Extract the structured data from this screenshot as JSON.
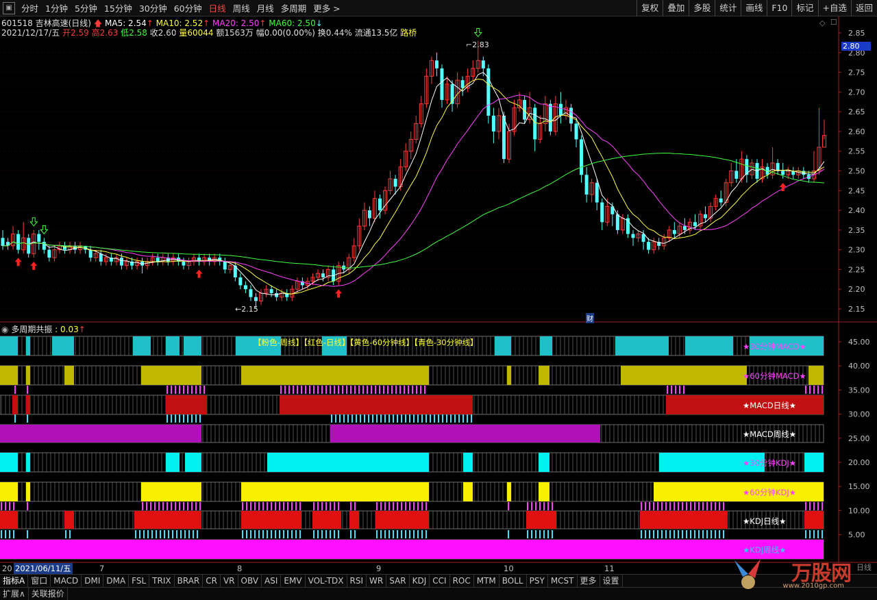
{
  "topbar": {
    "periods": [
      "分时",
      "1分钟",
      "5分钟",
      "15分钟",
      "30分钟",
      "60分钟",
      "日线",
      "周线",
      "月线",
      "多周期",
      "更多 >"
    ],
    "active_period": "日线",
    "right_buttons": [
      "复权",
      "叠加",
      "多股",
      "统计",
      "画线",
      "F10",
      "标记",
      "+自选",
      "返回"
    ]
  },
  "stock": {
    "code_name": "601518 吉林高速(日线)",
    "ma5": "MA5: 2.54",
    "ma10": "MA10: 2.52",
    "ma20": "MA20: 2.50",
    "ma60": "MA60: 2.50",
    "date": "2021/12/17/五",
    "open_label": "开",
    "open": "2.59",
    "high_label": "高",
    "high": "2.63",
    "low_label": "低",
    "low": "2.58",
    "close_label": "收",
    "close": "2.60",
    "vol_label": "量",
    "vol": "60044",
    "amount": "额1563万",
    "change": "幅0.00(0.00%)",
    "turnover": "换0.44%",
    "float": "流通13.5亿",
    "concept": "路桥"
  },
  "colors": {
    "up": "#ff3b3b",
    "down": "#54ffff",
    "ma5": "#ffffff",
    "ma10": "#ffff40",
    "ma20": "#ff40ff",
    "ma60": "#40ff40"
  },
  "price_axis": {
    "ticks": [
      "2.85",
      "2.80",
      "2.75",
      "2.70",
      "2.65",
      "2.60",
      "2.55",
      "2.50",
      "2.45",
      "2.40",
      "2.35",
      "2.30",
      "2.25",
      "2.20",
      "2.15"
    ],
    "current": "2.80"
  },
  "annotations": {
    "high": "2.83",
    "low": "2.15",
    "cai_icon": "财"
  },
  "indicator": {
    "title": "多周期共振",
    "value": ": 0.03",
    "legend": "【粉色-周线】【红色-日线】【黄色-60分钟线】【青色-30分钟线】",
    "axis_ticks": [
      "45.00",
      "40.00",
      "35.00",
      "30.00",
      "25.00",
      "20.00",
      "15.00",
      "10.00",
      "5.00"
    ],
    "row_labels": [
      "★30分钟MACD★",
      "★60分钟MACD★",
      "★MACD日线★",
      "★MACD周线★",
      "★30分钟KDJ★",
      "★60分钟KDJ★",
      "★KDJ日线★",
      "★KDJ周线★"
    ]
  },
  "date_axis": {
    "current": "2021/06/11/五",
    "prefix": "20",
    "months": [
      "7",
      "8",
      "9",
      "10",
      "11"
    ]
  },
  "bottom_tabs": [
    "指标A",
    "窗口",
    "MACD",
    "DMI",
    "DMA",
    "FSL",
    "TRIX",
    "BRAR",
    "CR",
    "VR",
    "OBV",
    "ASI",
    "EMV",
    "VOL-TDX",
    "RSI",
    "WR",
    "SAR",
    "KDJ",
    "CCI",
    "ROC",
    "MTM",
    "BOLL",
    "PSY",
    "MCST",
    "更多",
    "设置"
  ],
  "bottom_bar2": [
    "扩展∧",
    "关联报价"
  ],
  "watermark": {
    "text": "万股网",
    "sub": "www.2010gp.com",
    "right_label": "日线"
  },
  "chart_data": {
    "type": "candlestick",
    "ylim": [
      2.14,
      2.87
    ],
    "candles": [
      [
        2.33,
        2.31,
        2.35,
        2.3
      ],
      [
        2.32,
        2.31,
        2.33,
        2.3
      ],
      [
        2.31,
        2.34,
        2.36,
        2.3
      ],
      [
        2.34,
        2.3,
        2.35,
        2.29
      ],
      [
        2.3,
        2.33,
        2.37,
        2.29
      ],
      [
        2.33,
        2.29,
        2.34,
        2.28
      ],
      [
        2.29,
        2.34,
        2.35,
        2.28
      ],
      [
        2.34,
        2.32,
        2.35,
        2.3
      ],
      [
        2.32,
        2.3,
        2.33,
        2.29
      ],
      [
        2.3,
        2.28,
        2.31,
        2.27
      ],
      [
        2.28,
        2.3,
        2.31,
        2.27
      ],
      [
        2.3,
        2.31,
        2.32,
        2.29
      ],
      [
        2.31,
        2.3,
        2.32,
        2.29
      ],
      [
        2.3,
        2.31,
        2.32,
        2.29
      ],
      [
        2.31,
        2.3,
        2.32,
        2.29
      ],
      [
        2.3,
        2.31,
        2.32,
        2.29
      ],
      [
        2.31,
        2.3,
        2.31,
        2.29
      ],
      [
        2.3,
        2.28,
        2.31,
        2.27
      ],
      [
        2.28,
        2.29,
        2.3,
        2.27
      ],
      [
        2.29,
        2.27,
        2.3,
        2.26
      ],
      [
        2.27,
        2.28,
        2.29,
        2.26
      ],
      [
        2.28,
        2.27,
        2.29,
        2.26
      ],
      [
        2.27,
        2.28,
        2.29,
        2.26
      ],
      [
        2.28,
        2.26,
        2.29,
        2.25
      ],
      [
        2.26,
        2.27,
        2.28,
        2.25
      ],
      [
        2.27,
        2.26,
        2.28,
        2.25
      ],
      [
        2.26,
        2.27,
        2.28,
        2.25
      ],
      [
        2.27,
        2.26,
        2.28,
        2.24
      ],
      [
        2.26,
        2.27,
        2.28,
        2.25
      ],
      [
        2.27,
        2.28,
        2.29,
        2.26
      ],
      [
        2.28,
        2.27,
        2.29,
        2.26
      ],
      [
        2.27,
        2.28,
        2.29,
        2.26
      ],
      [
        2.28,
        2.27,
        2.29,
        2.26
      ],
      [
        2.27,
        2.28,
        2.29,
        2.26
      ],
      [
        2.28,
        2.27,
        2.29,
        2.26
      ],
      [
        2.27,
        2.26,
        2.28,
        2.25
      ],
      [
        2.26,
        2.27,
        2.28,
        2.25
      ],
      [
        2.27,
        2.28,
        2.29,
        2.26
      ],
      [
        2.28,
        2.27,
        2.29,
        2.26
      ],
      [
        2.27,
        2.28,
        2.29,
        2.26
      ],
      [
        2.28,
        2.27,
        2.29,
        2.26
      ],
      [
        2.27,
        2.28,
        2.29,
        2.26
      ],
      [
        2.28,
        2.27,
        2.29,
        2.26
      ],
      [
        2.27,
        2.25,
        2.28,
        2.24
      ],
      [
        2.25,
        2.26,
        2.27,
        2.24
      ],
      [
        2.26,
        2.23,
        2.27,
        2.22
      ],
      [
        2.23,
        2.21,
        2.24,
        2.2
      ],
      [
        2.21,
        2.2,
        2.22,
        2.19
      ],
      [
        2.2,
        2.18,
        2.21,
        2.17
      ],
      [
        2.18,
        2.17,
        2.19,
        2.15
      ],
      [
        2.17,
        2.19,
        2.2,
        2.16
      ],
      [
        2.19,
        2.2,
        2.21,
        2.18
      ],
      [
        2.2,
        2.19,
        2.21,
        2.18
      ],
      [
        2.19,
        2.18,
        2.2,
        2.17
      ],
      [
        2.18,
        2.19,
        2.2,
        2.17
      ],
      [
        2.19,
        2.18,
        2.2,
        2.17
      ],
      [
        2.18,
        2.2,
        2.21,
        2.17
      ],
      [
        2.2,
        2.22,
        2.23,
        2.19
      ],
      [
        2.22,
        2.21,
        2.23,
        2.2
      ],
      [
        2.21,
        2.22,
        2.23,
        2.2
      ],
      [
        2.22,
        2.23,
        2.24,
        2.21
      ],
      [
        2.23,
        2.24,
        2.25,
        2.22
      ],
      [
        2.24,
        2.23,
        2.25,
        2.22
      ],
      [
        2.23,
        2.25,
        2.26,
        2.22
      ],
      [
        2.25,
        2.22,
        2.26,
        2.21
      ],
      [
        2.22,
        2.26,
        2.27,
        2.21
      ],
      [
        2.26,
        2.25,
        2.27,
        2.24
      ],
      [
        2.25,
        2.28,
        2.29,
        2.24
      ],
      [
        2.28,
        2.31,
        2.33,
        2.27
      ],
      [
        2.31,
        2.36,
        2.38,
        2.3
      ],
      [
        2.36,
        2.4,
        2.42,
        2.35
      ],
      [
        2.4,
        2.38,
        2.41,
        2.36
      ],
      [
        2.38,
        2.43,
        2.45,
        2.37
      ],
      [
        2.43,
        2.4,
        2.44,
        2.38
      ],
      [
        2.4,
        2.45,
        2.46,
        2.39
      ],
      [
        2.45,
        2.48,
        2.5,
        2.44
      ],
      [
        2.48,
        2.46,
        2.49,
        2.44
      ],
      [
        2.46,
        2.51,
        2.53,
        2.45
      ],
      [
        2.51,
        2.55,
        2.57,
        2.5
      ],
      [
        2.55,
        2.58,
        2.6,
        2.53
      ],
      [
        2.58,
        2.62,
        2.64,
        2.57
      ],
      [
        2.62,
        2.67,
        2.69,
        2.61
      ],
      [
        2.67,
        2.74,
        2.76,
        2.66
      ],
      [
        2.74,
        2.78,
        2.79,
        2.72
      ],
      [
        2.78,
        2.76,
        2.8,
        2.74
      ],
      [
        2.76,
        2.68,
        2.77,
        2.66
      ],
      [
        2.68,
        2.72,
        2.74,
        2.67
      ],
      [
        2.72,
        2.67,
        2.73,
        2.65
      ],
      [
        2.67,
        2.73,
        2.75,
        2.66
      ],
      [
        2.73,
        2.71,
        2.74,
        2.69
      ],
      [
        2.71,
        2.74,
        2.76,
        2.7
      ],
      [
        2.74,
        2.76,
        2.78,
        2.73
      ],
      [
        2.76,
        2.78,
        2.83,
        2.75
      ],
      [
        2.78,
        2.76,
        2.79,
        2.74
      ],
      [
        2.76,
        2.64,
        2.77,
        2.62
      ],
      [
        2.64,
        2.6,
        2.66,
        2.57
      ],
      [
        2.6,
        2.64,
        2.66,
        2.58
      ],
      [
        2.64,
        2.53,
        2.65,
        2.52
      ],
      [
        2.53,
        2.6,
        2.62,
        2.52
      ],
      [
        2.6,
        2.66,
        2.68,
        2.59
      ],
      [
        2.66,
        2.68,
        2.7,
        2.65
      ],
      [
        2.68,
        2.63,
        2.69,
        2.62
      ],
      [
        2.63,
        2.66,
        2.7,
        2.62
      ],
      [
        2.66,
        2.58,
        2.67,
        2.55
      ],
      [
        2.58,
        2.62,
        2.64,
        2.57
      ],
      [
        2.62,
        2.67,
        2.69,
        2.6
      ],
      [
        2.67,
        2.6,
        2.68,
        2.59
      ],
      [
        2.6,
        2.67,
        2.69,
        2.59
      ],
      [
        2.67,
        2.64,
        2.7,
        2.62
      ],
      [
        2.64,
        2.66,
        2.68,
        2.63
      ],
      [
        2.66,
        2.62,
        2.67,
        2.6
      ],
      [
        2.62,
        2.58,
        2.63,
        2.56
      ],
      [
        2.58,
        2.49,
        2.59,
        2.47
      ],
      [
        2.49,
        2.44,
        2.51,
        2.42
      ],
      [
        2.44,
        2.47,
        2.48,
        2.42
      ],
      [
        2.47,
        2.42,
        2.48,
        2.4
      ],
      [
        2.42,
        2.37,
        2.43,
        2.35
      ],
      [
        2.37,
        2.41,
        2.43,
        2.36
      ],
      [
        2.41,
        2.39,
        2.42,
        2.36
      ],
      [
        2.39,
        2.35,
        2.4,
        2.34
      ],
      [
        2.35,
        2.38,
        2.39,
        2.34
      ],
      [
        2.38,
        2.34,
        2.39,
        2.33
      ],
      [
        2.34,
        2.33,
        2.35,
        2.31
      ],
      [
        2.33,
        2.34,
        2.35,
        2.32
      ],
      [
        2.34,
        2.32,
        2.35,
        2.3
      ],
      [
        2.32,
        2.3,
        2.33,
        2.29
      ],
      [
        2.3,
        2.32,
        2.33,
        2.29
      ],
      [
        2.32,
        2.31,
        2.33,
        2.3
      ],
      [
        2.31,
        2.33,
        2.34,
        2.3
      ],
      [
        2.33,
        2.35,
        2.36,
        2.32
      ],
      [
        2.35,
        2.34,
        2.37,
        2.33
      ],
      [
        2.34,
        2.36,
        2.37,
        2.33
      ],
      [
        2.36,
        2.35,
        2.38,
        2.34
      ],
      [
        2.35,
        2.37,
        2.38,
        2.34
      ],
      [
        2.37,
        2.36,
        2.39,
        2.35
      ],
      [
        2.36,
        2.39,
        2.4,
        2.35
      ],
      [
        2.39,
        2.38,
        2.41,
        2.37
      ],
      [
        2.38,
        2.41,
        2.42,
        2.37
      ],
      [
        2.41,
        2.43,
        2.44,
        2.4
      ],
      [
        2.43,
        2.42,
        2.45,
        2.41
      ],
      [
        2.42,
        2.47,
        2.48,
        2.41
      ],
      [
        2.47,
        2.5,
        2.52,
        2.46
      ],
      [
        2.5,
        2.48,
        2.53,
        2.47
      ],
      [
        2.48,
        2.53,
        2.55,
        2.47
      ],
      [
        2.53,
        2.49,
        2.54,
        2.47
      ],
      [
        2.49,
        2.52,
        2.53,
        2.48
      ],
      [
        2.52,
        2.48,
        2.53,
        2.47
      ],
      [
        2.48,
        2.51,
        2.53,
        2.47
      ],
      [
        2.51,
        2.49,
        2.52,
        2.48
      ],
      [
        2.49,
        2.52,
        2.56,
        2.48
      ],
      [
        2.52,
        2.5,
        2.53,
        2.49
      ],
      [
        2.5,
        2.49,
        2.52,
        2.48
      ],
      [
        2.49,
        2.5,
        2.51,
        2.48
      ],
      [
        2.5,
        2.49,
        2.51,
        2.48
      ],
      [
        2.49,
        2.5,
        2.51,
        2.48
      ],
      [
        2.5,
        2.49,
        2.51,
        2.48
      ],
      [
        2.49,
        2.48,
        2.5,
        2.47
      ],
      [
        2.48,
        2.5,
        2.55,
        2.47
      ],
      [
        2.5,
        2.56,
        2.66,
        2.49
      ],
      [
        2.56,
        2.59,
        2.63,
        2.58
      ]
    ]
  }
}
